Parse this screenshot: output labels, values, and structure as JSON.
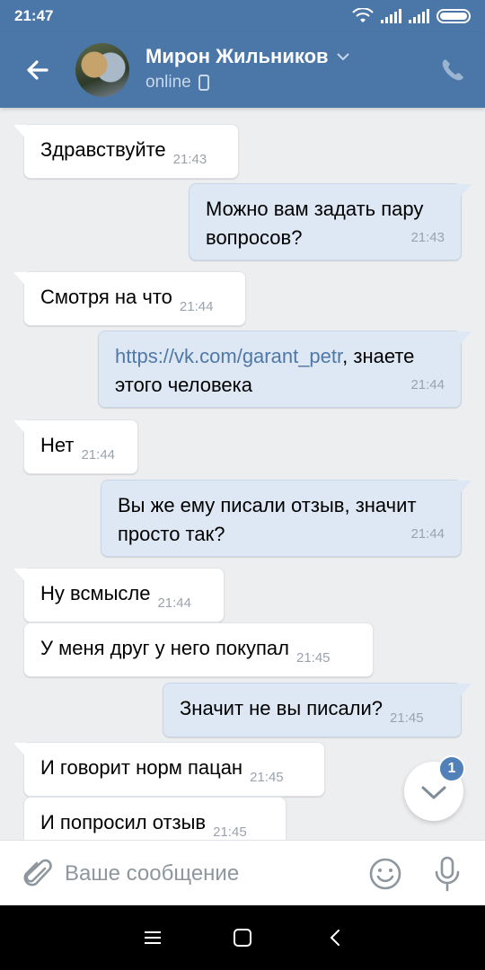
{
  "status_bar": {
    "time": "21:47"
  },
  "header": {
    "contact_name": "Мирон Жильников",
    "status": "online"
  },
  "messages": [
    {
      "dir": "in",
      "text": "Здравствуйте",
      "time": "21:43"
    },
    {
      "dir": "out",
      "text": "Можно вам задать пару вопросов?",
      "time": "21:43"
    },
    {
      "dir": "in",
      "text": "Смотря на что",
      "time": "21:44"
    },
    {
      "dir": "out",
      "link": "https://vk.com/garant_petr",
      "text": ", знаете этого человека",
      "time": "21:44"
    },
    {
      "dir": "in",
      "text": "Нет",
      "time": "21:44"
    },
    {
      "dir": "out",
      "text": "Вы же ему писали отзыв, значит просто так?",
      "time": "21:44"
    },
    {
      "dir": "in",
      "text": "Ну всмысле",
      "time": "21:44"
    },
    {
      "dir": "in",
      "text": "У меня друг у него покупал",
      "time": "21:45"
    },
    {
      "dir": "out",
      "text": "Значит не вы писали?",
      "time": "21:45"
    },
    {
      "dir": "in",
      "text": "И говорит норм пацан",
      "time": "21:45"
    },
    {
      "dir": "in",
      "text": "И попросил отзыв",
      "time": "21:45"
    }
  ],
  "scroll_down": {
    "unread_count": "1"
  },
  "composer": {
    "placeholder": "Ваше сообщение"
  },
  "colors": {
    "header": "#4a76a8",
    "outgoing_bubble": "#dde8f4",
    "incoming_bubble": "#ffffff",
    "link": "#4f78a6"
  },
  "icons": [
    "back-arrow-icon",
    "phone-icon",
    "chevron-down-icon",
    "mobile-icon",
    "paperclip-icon",
    "smile-icon",
    "microphone-icon",
    "chevron-down-icon"
  ]
}
